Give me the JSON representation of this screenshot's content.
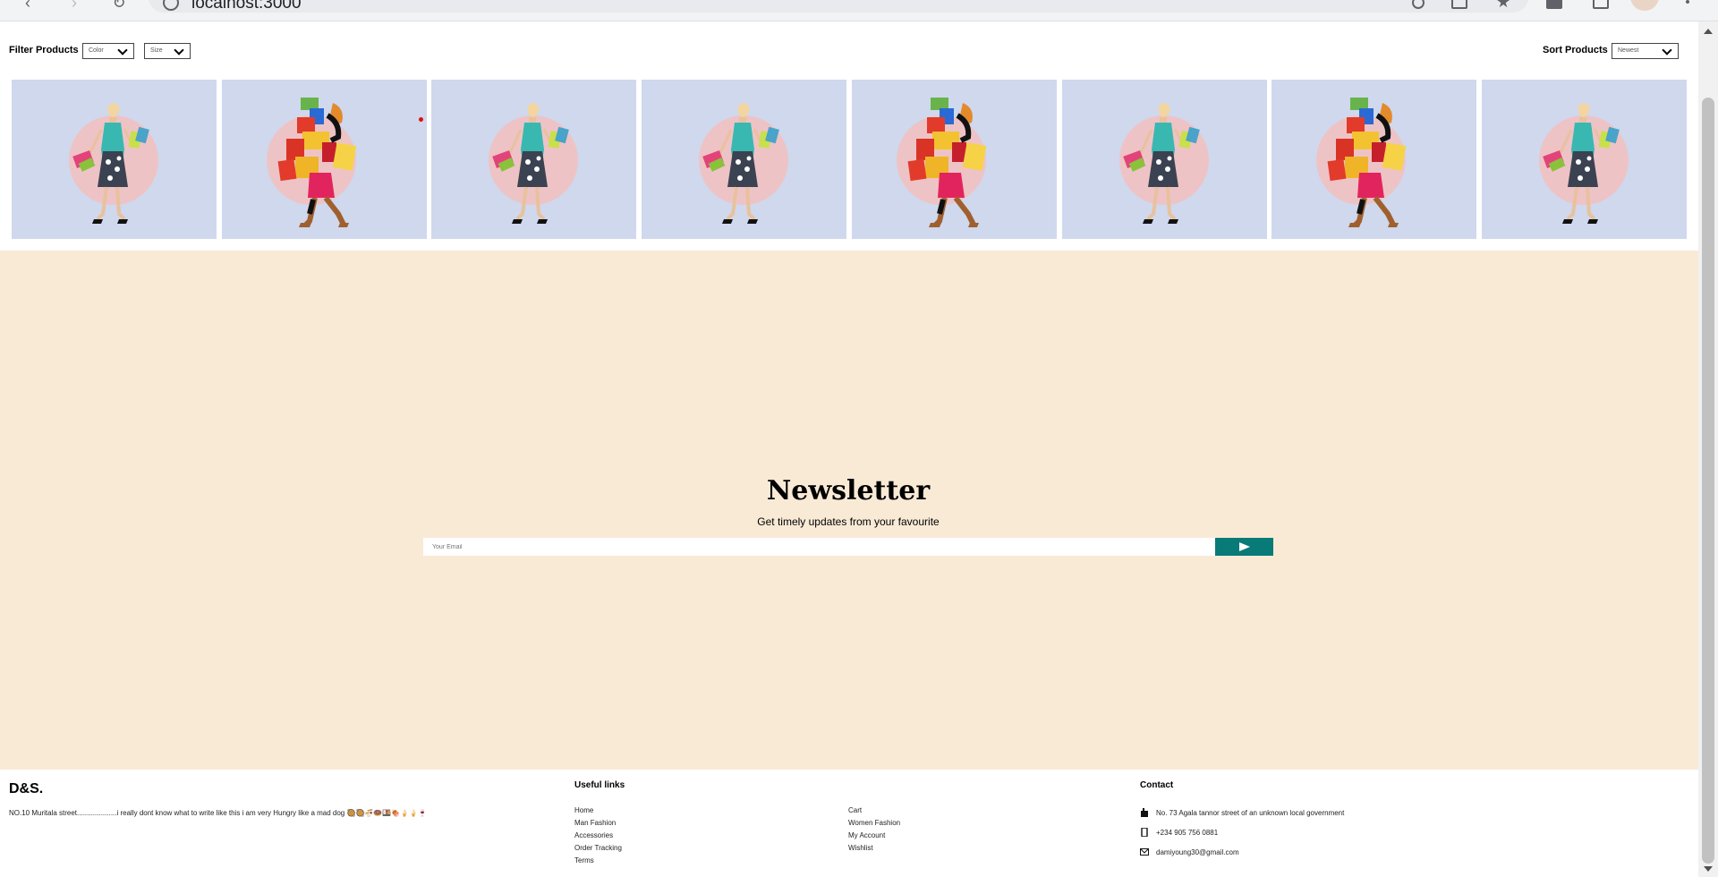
{
  "browser": {
    "url": "localhost:3000"
  },
  "filter": {
    "title": "Filter Products",
    "color_label": "Color",
    "size_label": "Size"
  },
  "sort": {
    "title": "Sort Products",
    "selected": "Newest"
  },
  "products": [
    {
      "variant": "dress"
    },
    {
      "variant": "boxes"
    },
    {
      "variant": "dress"
    },
    {
      "variant": "dress"
    },
    {
      "variant": "boxes"
    },
    {
      "variant": "dress"
    },
    {
      "variant": "boxes"
    },
    {
      "variant": "dress"
    }
  ],
  "newsletter": {
    "title": "Newsletter",
    "description": "Get timely updates from your favourite",
    "placeholder": "Your Email",
    "accent": "#087a77",
    "background": "#f9ead6"
  },
  "footer": {
    "logo": "D&S.",
    "about": "NO.10 Muritala street....................i really dont know what to write like this i am very Hungry like a mad dog 🥘🥘🍜🍩🍱🍖🍦🍦🍷",
    "useful_title": "Useful links",
    "links_col1": [
      "Home",
      "Man Fashion",
      "Accessories",
      "Order Tracking",
      "Terms"
    ],
    "links_col2": [
      "Cart",
      "Women Fashion",
      "My Account",
      "Wishlist"
    ],
    "contact_title": "Contact",
    "address": "No. 73 Agala tannor street of an unknown local government",
    "phone": "+234 905 756 0881",
    "email": "damiyoung30@gmail.com"
  }
}
